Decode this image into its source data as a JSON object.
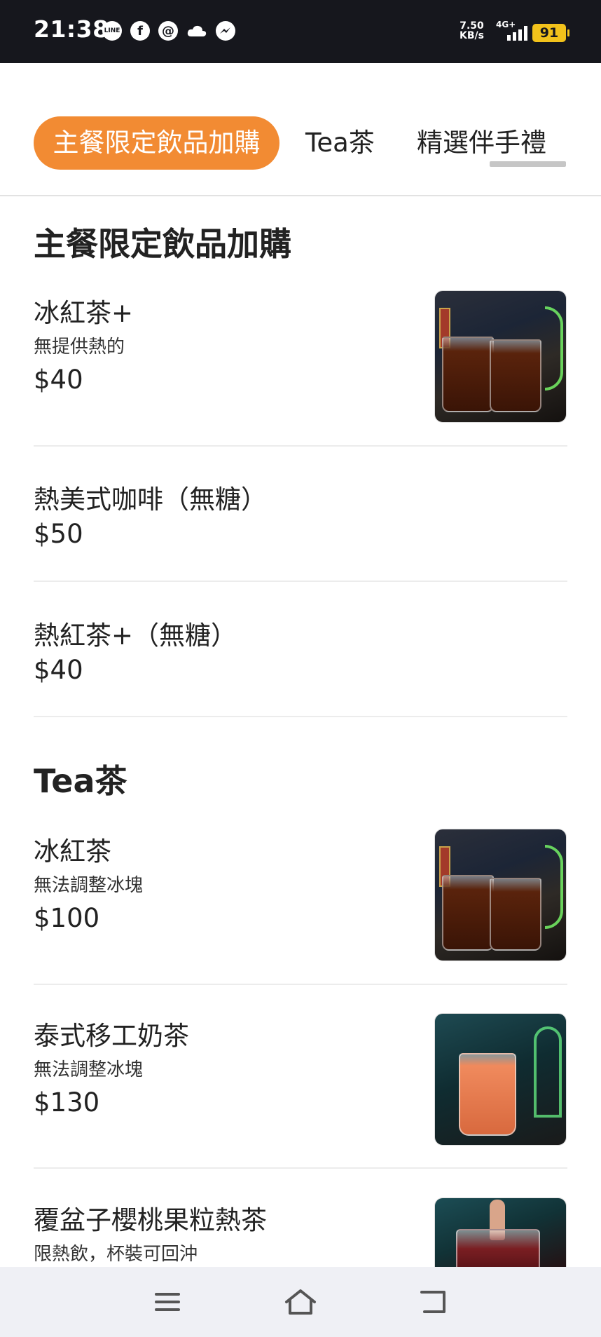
{
  "status_bar": {
    "time": "21:38",
    "app_icons": [
      "line-icon",
      "facebook-icon",
      "threads-icon",
      "cloud-icon",
      "messenger-icon"
    ],
    "net_speed_value": "7.50",
    "net_speed_unit": "KB/s",
    "network_type": "4G+",
    "battery": "91"
  },
  "tabs": [
    {
      "label": "主餐限定飲品加購",
      "active": true
    },
    {
      "label": "Tea茶",
      "active": false
    },
    {
      "label": "精選伴手禮",
      "active": false
    }
  ],
  "sections": [
    {
      "title": "主餐限定飲品加購",
      "items": [
        {
          "name": "冰紅茶+",
          "note": "無提供熱的",
          "price": "$40",
          "photo": "iced-black-tea"
        },
        {
          "name": "熱美式咖啡（無糖）",
          "note": "",
          "price": "$50",
          "photo": ""
        },
        {
          "name": "熱紅茶+（無糖）",
          "note": "",
          "price": "$40",
          "photo": ""
        }
      ]
    },
    {
      "title": "Tea茶",
      "items": [
        {
          "name": "冰紅茶",
          "note": "無法調整冰塊",
          "price": "$100",
          "photo": "iced-black-tea"
        },
        {
          "name": "泰式移工奶茶",
          "note": "無法調整冰塊",
          "price": "$130",
          "photo": "thai-milk-tea"
        },
        {
          "name": "覆盆子櫻桃果粒熱茶",
          "note": "限熱飲，杯裝可回沖",
          "price": "",
          "photo": "raspberry-cherry-tea"
        }
      ]
    }
  ],
  "nav": {
    "buttons": [
      "menu-icon",
      "home-icon",
      "back-icon"
    ]
  },
  "colors": {
    "accent": "#f28b33",
    "status_bar": "#16171d",
    "battery": "#f2c21b",
    "nav_bg": "#eff0f5"
  }
}
